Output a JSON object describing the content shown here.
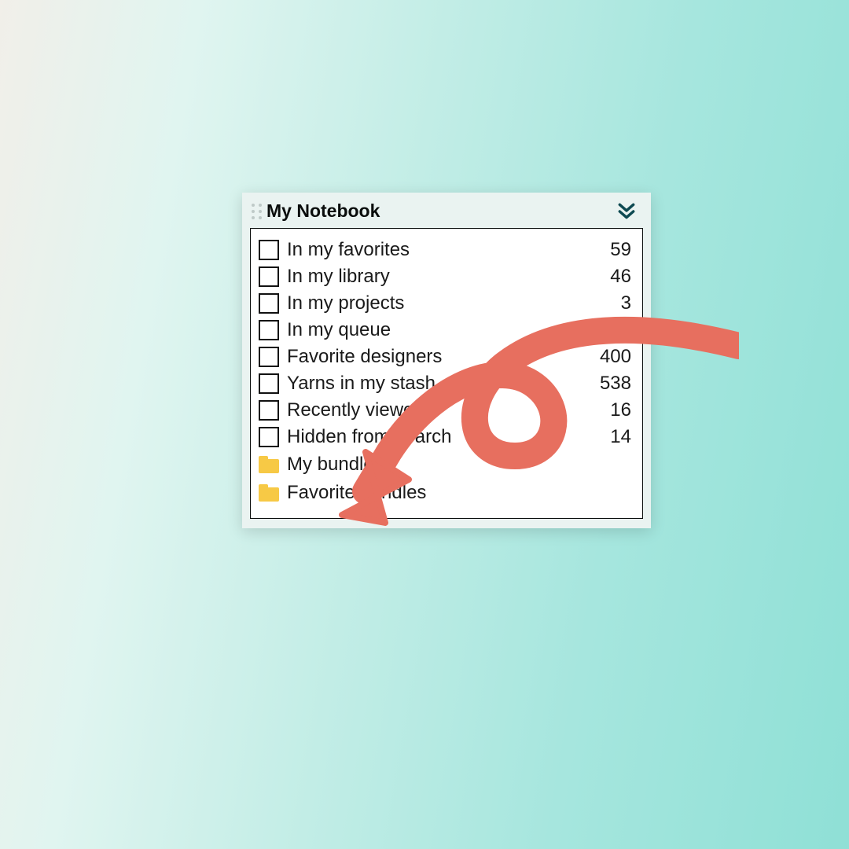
{
  "panel": {
    "title": "My Notebook",
    "items": [
      {
        "label": "In my favorites",
        "count": "59"
      },
      {
        "label": "In my library",
        "count": "46"
      },
      {
        "label": "In my projects",
        "count": "3"
      },
      {
        "label": "In my queue",
        "count": ""
      },
      {
        "label": "Favorite designers",
        "count": "400"
      },
      {
        "label": "Yarns in my stash",
        "count": "538"
      },
      {
        "label": "Recently viewed",
        "count": "16"
      },
      {
        "label": "Hidden from search",
        "count": "14"
      }
    ],
    "folders": [
      {
        "label": "My bundles"
      },
      {
        "label": "Favorite bundles"
      }
    ]
  },
  "icons": {
    "chevron_color": "#0e4a52",
    "arrow_color": "#e76f5f"
  }
}
